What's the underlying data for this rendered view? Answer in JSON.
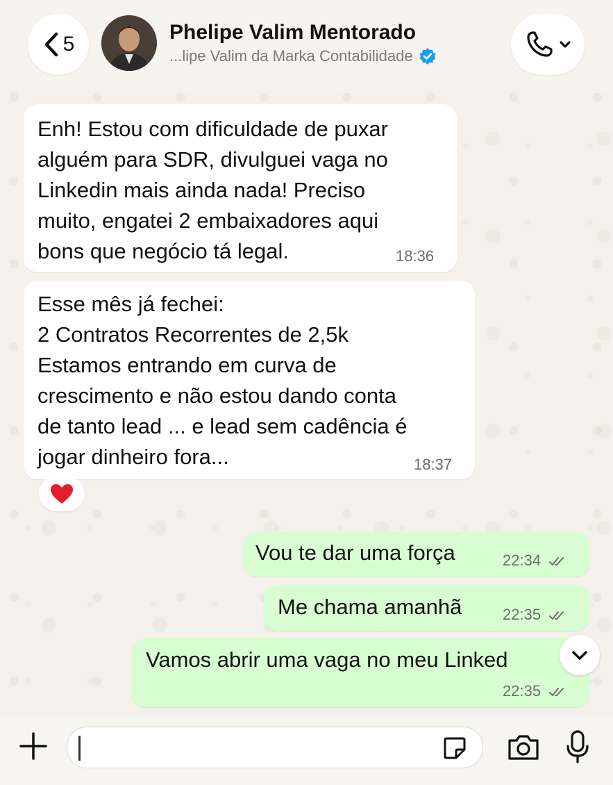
{
  "header": {
    "back_count": "5",
    "contact_name": "Phelipe Valim Mentorado",
    "contact_subtitle": "...lipe Valim da Marka Contabilidade",
    "verified": true
  },
  "messages": [
    {
      "direction": "incoming",
      "text": "Enh! Estou com dificuldade de puxar\nalguém para SDR, divulguei vaga no\nLinkedin mais ainda nada! Preciso\nmuito, engatei 2 embaixadores aqui\nbons que negócio tá legal.",
      "time": "18:36"
    },
    {
      "direction": "incoming",
      "text": "Esse mês já fechei:\n2 Contratos Recorrentes de 2,5k\nEstamos entrando em curva de\ncrescimento e não estou dando conta\nde tanto lead ... e lead sem cadência é\njogar dinheiro fora...",
      "time": "18:37",
      "reaction": "❤️"
    },
    {
      "direction": "outgoing",
      "text": "Vou te dar uma força",
      "time": "22:34",
      "status": "read"
    },
    {
      "direction": "outgoing",
      "text": "Me chama amanhã",
      "time": "22:35",
      "status": "read"
    },
    {
      "direction": "outgoing",
      "text": "Vamos abrir uma vaga no meu Linked",
      "time": "22:35",
      "status": "read"
    }
  ],
  "composer": {
    "input_value": ""
  },
  "colors": {
    "incoming_bubble": "#ffffff",
    "outgoing_bubble": "#d9fdd3",
    "verified": "#1d9bf0",
    "heart": "#e0202e",
    "read_ticks": "#6d6d6d"
  }
}
